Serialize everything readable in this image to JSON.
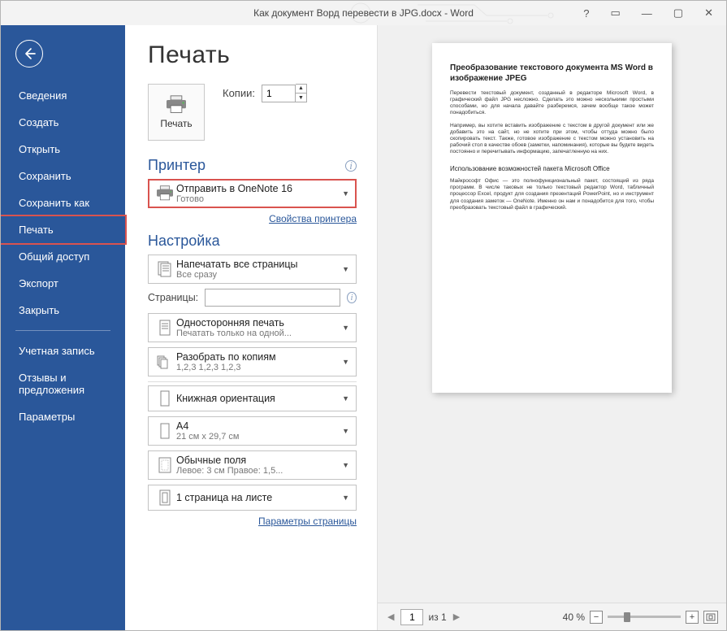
{
  "window": {
    "title": "Как документ Ворд перевести в JPG.docx  -  Word",
    "help": "?",
    "minimize": "—",
    "maximize": "▢",
    "close": "✕"
  },
  "sidebar": {
    "items": [
      {
        "label": "Сведения"
      },
      {
        "label": "Создать"
      },
      {
        "label": "Открыть"
      },
      {
        "label": "Сохранить"
      },
      {
        "label": "Сохранить как"
      },
      {
        "label": "Печать"
      },
      {
        "label": "Общий доступ"
      },
      {
        "label": "Экспорт"
      },
      {
        "label": "Закрыть"
      }
    ],
    "items2": [
      {
        "label": "Учетная запись"
      },
      {
        "label": "Отзывы и предложения"
      },
      {
        "label": "Параметры"
      }
    ]
  },
  "print": {
    "heading": "Печать",
    "print_label": "Печать",
    "copies_label": "Копии:",
    "copies_value": "1",
    "printer_section": "Принтер",
    "printer": {
      "name": "Отправить в OneNote 16",
      "status": "Готово"
    },
    "printer_props": "Свойства принтера",
    "settings_section": "Настройка",
    "opt_print_all": {
      "primary": "Напечатать все страницы",
      "secondary": "Все сразу"
    },
    "pages_label": "Страницы:",
    "pages_value": "",
    "opt_one_sided": {
      "primary": "Односторонняя печать",
      "secondary": "Печатать только на одной..."
    },
    "opt_collate": {
      "primary": "Разобрать по копиям",
      "secondary": "1,2,3    1,2,3    1,2,3"
    },
    "opt_orient": {
      "primary": "Книжная ориентация",
      "secondary": ""
    },
    "opt_paper": {
      "primary": "A4",
      "secondary": "21 см x 29,7 см"
    },
    "opt_margins": {
      "primary": "Обычные поля",
      "secondary": "Левое:  3 см    Правое:  1,5..."
    },
    "opt_perpage": {
      "primary": "1 страница на листе",
      "secondary": ""
    },
    "page_setup": "Параметры страницы"
  },
  "preview": {
    "title": "Преобразование текстового документа MS Word в изображение JPEG",
    "p1": "Перевести текстовый документ, созданный в редакторе Microsoft Word, в графический файл JPG несложно. Сделать это можно несколькими простыми способами, но для начала давайте разберемся, зачем вообще такое может понадобиться.",
    "p2": "Например, вы хотите вставить изображение с текстом в другой документ или же добавить это на сайт, но не хотите при этом, чтобы оттуда можно было скопировать текст. Также, готовое изображение с текстом можно установить на рабочий стол в качестве обоев (заметки, напоминания), которые вы будете видеть постоянно и перечитывать информацию, запечатленную на них.",
    "sub": "Использование возможностей пакета Microsoft Office",
    "p3": "Майкрософт Офис — это полнофункциональный пакет, состоящий из ряда программ. В числе таковых не только текстовый редактор Word, табличный процессор Excel, продукт для создания презентаций PowerPoint, но и инструмент для создания заметок — OneNote. Именно он нам и понадобится для того, чтобы преобразовать текстовый файл в графический.",
    "page_current": "1",
    "page_total": "из 1",
    "zoom_pct": "40 %"
  }
}
